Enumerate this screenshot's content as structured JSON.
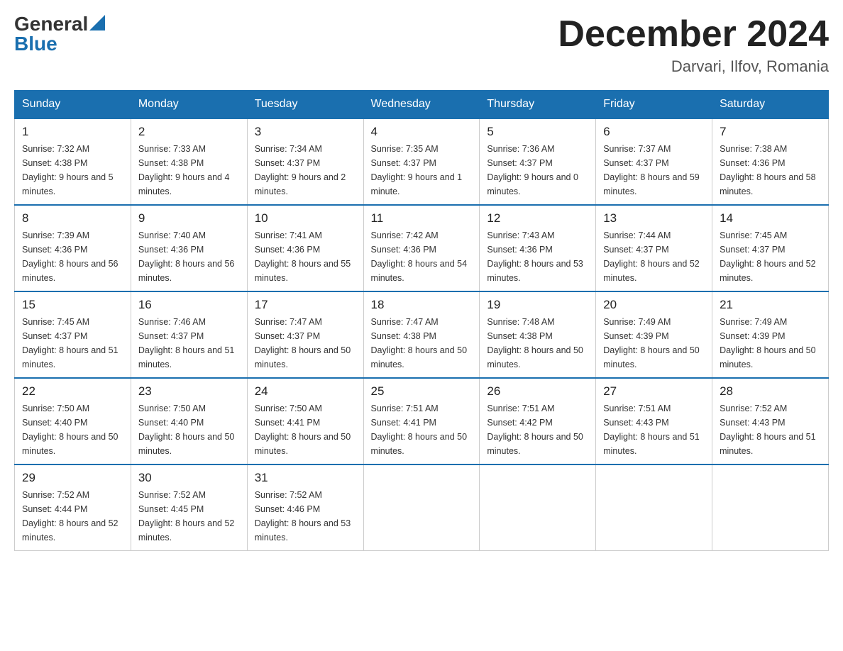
{
  "header": {
    "logo_general": "General",
    "logo_blue": "Blue",
    "title": "December 2024",
    "subtitle": "Darvari, Ilfov, Romania"
  },
  "days_of_week": [
    "Sunday",
    "Monday",
    "Tuesday",
    "Wednesday",
    "Thursday",
    "Friday",
    "Saturday"
  ],
  "weeks": [
    [
      {
        "day": "1",
        "sunrise": "7:32 AM",
        "sunset": "4:38 PM",
        "daylight": "9 hours and 5 minutes."
      },
      {
        "day": "2",
        "sunrise": "7:33 AM",
        "sunset": "4:38 PM",
        "daylight": "9 hours and 4 minutes."
      },
      {
        "day": "3",
        "sunrise": "7:34 AM",
        "sunset": "4:37 PM",
        "daylight": "9 hours and 2 minutes."
      },
      {
        "day": "4",
        "sunrise": "7:35 AM",
        "sunset": "4:37 PM",
        "daylight": "9 hours and 1 minute."
      },
      {
        "day": "5",
        "sunrise": "7:36 AM",
        "sunset": "4:37 PM",
        "daylight": "9 hours and 0 minutes."
      },
      {
        "day": "6",
        "sunrise": "7:37 AM",
        "sunset": "4:37 PM",
        "daylight": "8 hours and 59 minutes."
      },
      {
        "day": "7",
        "sunrise": "7:38 AM",
        "sunset": "4:36 PM",
        "daylight": "8 hours and 58 minutes."
      }
    ],
    [
      {
        "day": "8",
        "sunrise": "7:39 AM",
        "sunset": "4:36 PM",
        "daylight": "8 hours and 56 minutes."
      },
      {
        "day": "9",
        "sunrise": "7:40 AM",
        "sunset": "4:36 PM",
        "daylight": "8 hours and 56 minutes."
      },
      {
        "day": "10",
        "sunrise": "7:41 AM",
        "sunset": "4:36 PM",
        "daylight": "8 hours and 55 minutes."
      },
      {
        "day": "11",
        "sunrise": "7:42 AM",
        "sunset": "4:36 PM",
        "daylight": "8 hours and 54 minutes."
      },
      {
        "day": "12",
        "sunrise": "7:43 AM",
        "sunset": "4:36 PM",
        "daylight": "8 hours and 53 minutes."
      },
      {
        "day": "13",
        "sunrise": "7:44 AM",
        "sunset": "4:37 PM",
        "daylight": "8 hours and 52 minutes."
      },
      {
        "day": "14",
        "sunrise": "7:45 AM",
        "sunset": "4:37 PM",
        "daylight": "8 hours and 52 minutes."
      }
    ],
    [
      {
        "day": "15",
        "sunrise": "7:45 AM",
        "sunset": "4:37 PM",
        "daylight": "8 hours and 51 minutes."
      },
      {
        "day": "16",
        "sunrise": "7:46 AM",
        "sunset": "4:37 PM",
        "daylight": "8 hours and 51 minutes."
      },
      {
        "day": "17",
        "sunrise": "7:47 AM",
        "sunset": "4:37 PM",
        "daylight": "8 hours and 50 minutes."
      },
      {
        "day": "18",
        "sunrise": "7:47 AM",
        "sunset": "4:38 PM",
        "daylight": "8 hours and 50 minutes."
      },
      {
        "day": "19",
        "sunrise": "7:48 AM",
        "sunset": "4:38 PM",
        "daylight": "8 hours and 50 minutes."
      },
      {
        "day": "20",
        "sunrise": "7:49 AM",
        "sunset": "4:39 PM",
        "daylight": "8 hours and 50 minutes."
      },
      {
        "day": "21",
        "sunrise": "7:49 AM",
        "sunset": "4:39 PM",
        "daylight": "8 hours and 50 minutes."
      }
    ],
    [
      {
        "day": "22",
        "sunrise": "7:50 AM",
        "sunset": "4:40 PM",
        "daylight": "8 hours and 50 minutes."
      },
      {
        "day": "23",
        "sunrise": "7:50 AM",
        "sunset": "4:40 PM",
        "daylight": "8 hours and 50 minutes."
      },
      {
        "day": "24",
        "sunrise": "7:50 AM",
        "sunset": "4:41 PM",
        "daylight": "8 hours and 50 minutes."
      },
      {
        "day": "25",
        "sunrise": "7:51 AM",
        "sunset": "4:41 PM",
        "daylight": "8 hours and 50 minutes."
      },
      {
        "day": "26",
        "sunrise": "7:51 AM",
        "sunset": "4:42 PM",
        "daylight": "8 hours and 50 minutes."
      },
      {
        "day": "27",
        "sunrise": "7:51 AM",
        "sunset": "4:43 PM",
        "daylight": "8 hours and 51 minutes."
      },
      {
        "day": "28",
        "sunrise": "7:52 AM",
        "sunset": "4:43 PM",
        "daylight": "8 hours and 51 minutes."
      }
    ],
    [
      {
        "day": "29",
        "sunrise": "7:52 AM",
        "sunset": "4:44 PM",
        "daylight": "8 hours and 52 minutes."
      },
      {
        "day": "30",
        "sunrise": "7:52 AM",
        "sunset": "4:45 PM",
        "daylight": "8 hours and 52 minutes."
      },
      {
        "day": "31",
        "sunrise": "7:52 AM",
        "sunset": "4:46 PM",
        "daylight": "8 hours and 53 minutes."
      },
      null,
      null,
      null,
      null
    ]
  ]
}
